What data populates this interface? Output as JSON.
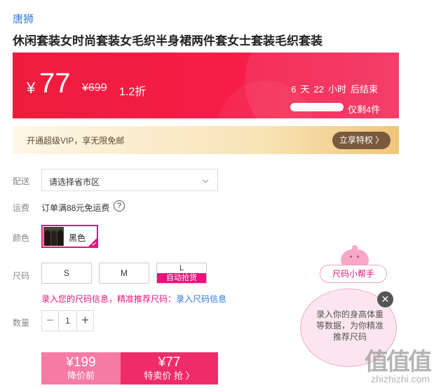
{
  "product": {
    "brand": "唐狮",
    "title": "休闲套装女时尚套装女毛织半身裙两件套女士套装毛织套装"
  },
  "price_banner": {
    "currency": "¥",
    "price": "77",
    "original_price": "¥699",
    "discount": "1.2折",
    "countdown": {
      "days": "6",
      "days_unit": "天",
      "hours": "22",
      "hours_unit": "小时",
      "suffix": "后结束"
    },
    "stock_text": "仅剩4件",
    "colors": {
      "start": "#ee1c3c",
      "end": "#f42e5e"
    }
  },
  "vip": {
    "text": "开通超级VIP，享无限免邮",
    "button": "立享特权 〉"
  },
  "delivery": {
    "label": "配送",
    "placeholder": "请选择省市区"
  },
  "shipping": {
    "label": "运费",
    "text": "订单满88元免运费",
    "help": "?"
  },
  "color": {
    "label": "颜色",
    "selected": "黑色"
  },
  "size": {
    "label": "尺码",
    "options": [
      "S",
      "M",
      "L"
    ],
    "auto_grab": "自动抢货",
    "hint": "录入您的尺码信息，精准推荐尺码：",
    "hint_link": "录入尺码信息"
  },
  "quantity": {
    "label": "数量",
    "value": "1",
    "minus": "−",
    "plus": "+"
  },
  "buy": {
    "before_price": "¥199",
    "before_label": "降价前",
    "now_price": "¥77",
    "now_label": "特卖价 抢 〉"
  },
  "size_helper": {
    "title": "尺码小帮手",
    "tip": "录入你的身高体重等数据，为你精准推荐尺码",
    "close": "✕"
  },
  "watermark": {
    "logo": "值值值",
    "url": "zhizhizhi.com"
  },
  "accent": "#e8127e"
}
